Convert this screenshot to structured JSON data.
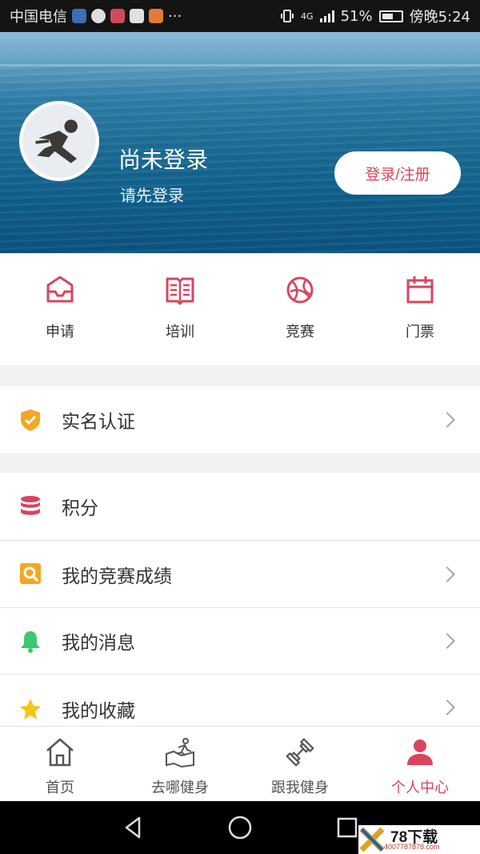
{
  "status_bar": {
    "carrier": "中国电信",
    "more": "···",
    "network": "4G",
    "battery": "51%",
    "time": "傍晚5:24"
  },
  "header": {
    "title": "尚未登录",
    "subtitle": "请先登录",
    "login_button": "登录/注册"
  },
  "quick_entries": [
    {
      "label": "申请",
      "icon": "inbox-icon"
    },
    {
      "label": "培训",
      "icon": "book-icon"
    },
    {
      "label": "竞赛",
      "icon": "basketball-icon"
    },
    {
      "label": "门票",
      "icon": "calendar-icon"
    }
  ],
  "menu": {
    "verify": {
      "label": "实名认证",
      "icon": "shield-check-icon"
    },
    "points": {
      "label": "积分",
      "icon": "database-icon"
    },
    "scores": {
      "label": "我的竞赛成绩",
      "icon": "search-document-icon"
    },
    "messages": {
      "label": "我的消息",
      "icon": "bell-icon"
    },
    "favorites": {
      "label": "我的收藏",
      "icon": "star-icon"
    }
  },
  "tabs": [
    {
      "label": "首页",
      "icon": "home-icon"
    },
    {
      "label": "去哪健身",
      "icon": "runner-map-icon"
    },
    {
      "label": "跟我健身",
      "icon": "dumbbell-icon"
    },
    {
      "label": "个人中心",
      "icon": "person-icon"
    }
  ],
  "watermark": {
    "brand": "78下载",
    "site": "4007787878.com"
  },
  "colors": {
    "accent": "#d8455d",
    "shield": "#f5a623",
    "bell": "#3cc86e",
    "star": "#f5c518"
  }
}
